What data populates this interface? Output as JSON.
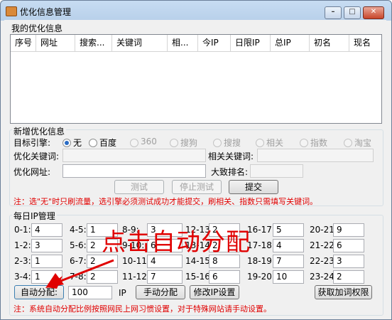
{
  "window": {
    "title": "优化信息管理",
    "controls": {
      "minimize": "–",
      "maximize": "□",
      "close": "✕"
    }
  },
  "my_opt": {
    "group_title": "我的优化信息",
    "columns": [
      "序号",
      "网址",
      "搜索...",
      "关键词",
      "相...",
      "今IP",
      "日限IP",
      "总IP",
      "初名",
      "现名"
    ]
  },
  "new_opt": {
    "group_title": "新增优化信息",
    "engine_label": "目标引擎:",
    "engines": [
      {
        "label": "无",
        "selected": true,
        "enabled": true
      },
      {
        "label": "百度",
        "selected": false,
        "enabled": true
      },
      {
        "label": "360",
        "selected": false,
        "enabled": false
      },
      {
        "label": "搜狗",
        "selected": false,
        "enabled": false
      },
      {
        "label": "搜搜",
        "selected": false,
        "enabled": false
      },
      {
        "label": "相关",
        "selected": false,
        "enabled": false
      },
      {
        "label": "指数",
        "selected": false,
        "enabled": false
      },
      {
        "label": "淘宝",
        "selected": false,
        "enabled": false
      }
    ],
    "keyword_label": "优化关键词:",
    "related_label": "相关关键词:",
    "url_label": "优化网址:",
    "rank_label": "大致排名:",
    "test_button": "测试",
    "stop_button": "停止测试",
    "submit_button": "提交",
    "note": "注：选\"无\"时只刷流量，选引擎必须测试成功才能提交，刷相关、指数只需填写关键词。"
  },
  "daily_ip": {
    "group_title": "每日IP管理",
    "slots": [
      {
        "label": "0-1:",
        "value": "4"
      },
      {
        "label": "4-5:",
        "value": "1"
      },
      {
        "label": "8-9:",
        "value": "3"
      },
      {
        "label": "12-13:",
        "value": "2"
      },
      {
        "label": "16-17:",
        "value": "5"
      },
      {
        "label": "20-21:",
        "value": "9"
      },
      {
        "label": "1-2:",
        "value": "3"
      },
      {
        "label": "5-6:",
        "value": "2"
      },
      {
        "label": "9-10:",
        "value": "6"
      },
      {
        "label": "13-14:",
        "value": "2"
      },
      {
        "label": "17-18:",
        "value": "4"
      },
      {
        "label": "21-22:",
        "value": "6"
      },
      {
        "label": "2-3:",
        "value": "1"
      },
      {
        "label": "6-7:",
        "value": "2"
      },
      {
        "label": "10-11:",
        "value": "4"
      },
      {
        "label": "14-15:",
        "value": "8"
      },
      {
        "label": "18-19:",
        "value": "7"
      },
      {
        "label": "22-23:",
        "value": "3"
      },
      {
        "label": "3-4:",
        "value": "1"
      },
      {
        "label": "7-8:",
        "value": "2"
      },
      {
        "label": "11-12:",
        "value": "7"
      },
      {
        "label": "15-16:",
        "value": "6"
      },
      {
        "label": "19-20:",
        "value": "10"
      },
      {
        "label": "23-24:",
        "value": "2"
      }
    ],
    "auto_button": "自动分配:",
    "total_value": "100",
    "ip_unit": "IP",
    "manual_button": "手动分配",
    "modify_button": "修改IP设置",
    "fetch_button": "获取加词权限",
    "note": "注：系统自动分配比例按照网民上网习惯设置，对于特殊网站请手动设置。"
  },
  "annotation": {
    "text": "点击自动分配",
    "color": "#e00000"
  }
}
